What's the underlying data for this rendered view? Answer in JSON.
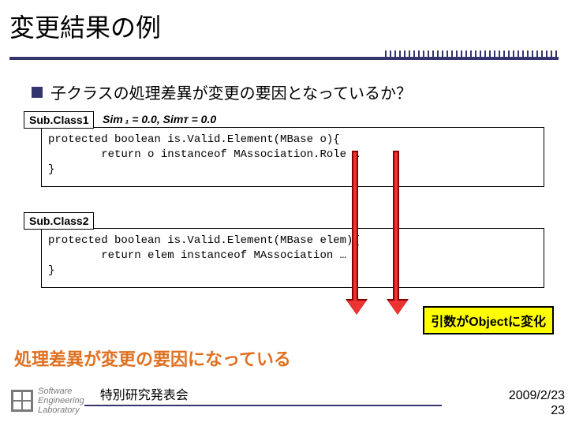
{
  "title": "変更結果の例",
  "bullet": "子クラスの処理差異が変更の要因となっているか？",
  "sim_text": "Sim ₁ = 0.0, Simᴛ = 0.0",
  "tag1": "Sub.Class1",
  "tag2": "Sub.Class2",
  "code1": "protected boolean is.Valid.Element(MBase o){\n        return o instanceof MAssociation.Role …\n}",
  "code2": "protected boolean is.Valid.Element(MBase elem){\n        return elem instanceof MAssociation …\n}",
  "callout": "引数がObjectに変化",
  "conclusion": "処理差異が変更の要因になっている",
  "logo": {
    "l1": "Software",
    "l2": "Engineering",
    "l3": "Laboratory"
  },
  "footer_center": "特別研究発表会",
  "footer_date": "2009/2/23",
  "footer_page": "23"
}
